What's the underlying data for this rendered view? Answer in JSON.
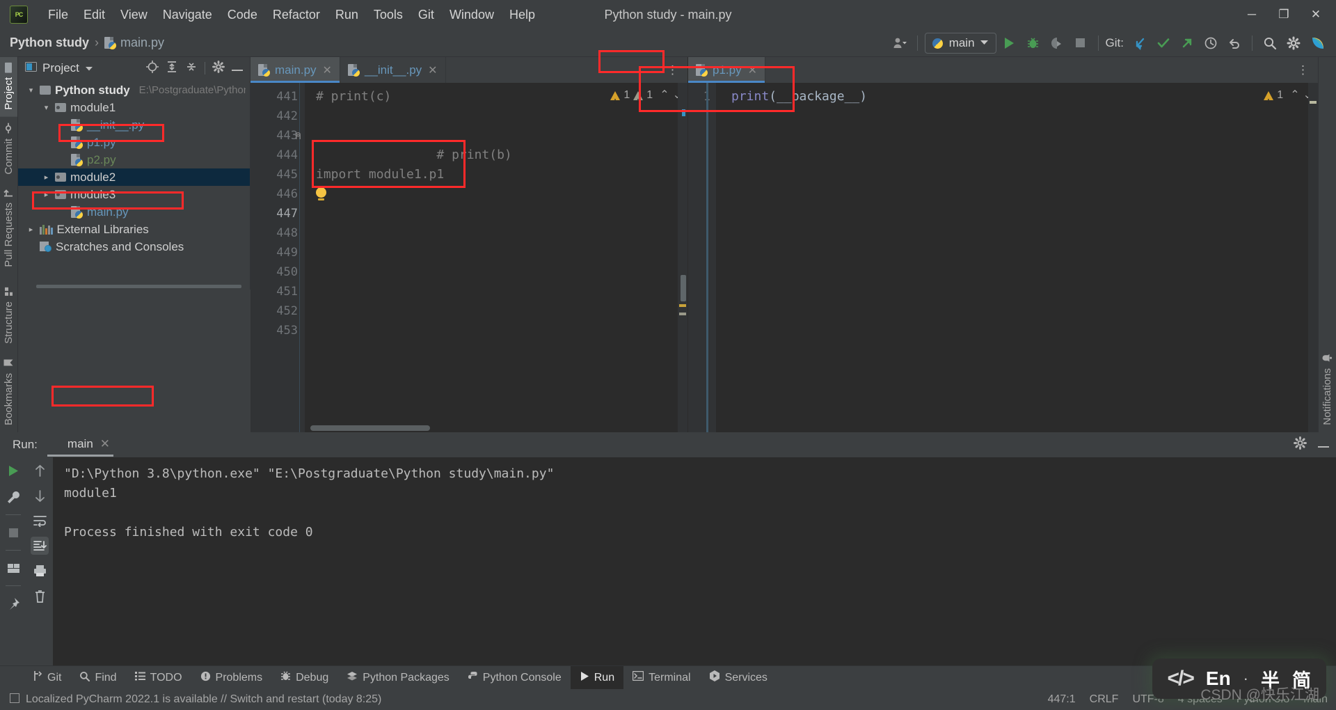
{
  "window": {
    "title": "Python study - main.py",
    "minimize": "─",
    "maximize": "❐",
    "close": "✕"
  },
  "menubar": {
    "logo": "PC",
    "items": [
      "File",
      "Edit",
      "View",
      "Navigate",
      "Code",
      "Refactor",
      "Run",
      "Tools",
      "Git",
      "Window",
      "Help"
    ]
  },
  "navbar": {
    "breadcrumb_project": "Python study",
    "breadcrumb_sep": "›",
    "breadcrumb_file": "main.py",
    "run_config": "main",
    "git_label": "Git:",
    "icons": {
      "account": "account-icon",
      "run": "run-icon",
      "debug": "debug-icon",
      "coverage": "coverage-icon",
      "stop": "stop-icon",
      "git_update": "git-update-icon",
      "git_commit": "git-commit-icon",
      "git_push": "git-push-icon",
      "git_history": "git-history-icon",
      "git_rollback": "git-rollback-icon",
      "search": "search-icon",
      "settings": "gear-icon",
      "plugin": "plugin-icon"
    }
  },
  "left_strip": {
    "top": [
      "Project",
      "Commit",
      "Pull Requests"
    ],
    "bottom": [
      "Structure",
      "Bookmarks"
    ],
    "active": "Project"
  },
  "right_strip": {
    "label": "Notifications"
  },
  "project_panel": {
    "title": "Project",
    "tree": [
      {
        "label": "Python study",
        "path": "E:\\Postgraduate\\Python s",
        "depth": 0,
        "kind": "root-folder",
        "expanded": true,
        "color": "white",
        "bold": true
      },
      {
        "label": "module1",
        "path": "",
        "depth": 1,
        "kind": "package-folder",
        "expanded": true,
        "color": "white",
        "bold": false
      },
      {
        "label": "__init__.py",
        "path": "",
        "depth": 2,
        "kind": "python-file",
        "color": "blue"
      },
      {
        "label": "p1.py",
        "path": "",
        "depth": 2,
        "kind": "python-file",
        "color": "blue",
        "highlighted": true
      },
      {
        "label": "p2.py",
        "path": "",
        "depth": 2,
        "kind": "python-file",
        "color": "green"
      },
      {
        "label": "module2",
        "path": "",
        "depth": 1,
        "kind": "package-folder",
        "expanded": false,
        "color": "white",
        "selected": true
      },
      {
        "label": "module3",
        "path": "",
        "depth": 1,
        "kind": "package-folder",
        "expanded": false,
        "color": "white"
      },
      {
        "label": "main.py",
        "path": "",
        "depth": 2,
        "kind": "python-file",
        "color": "blue",
        "highlighted": true
      },
      {
        "label": "External Libraries",
        "path": "",
        "depth": 0,
        "kind": "libraries",
        "expanded": false,
        "color": "white"
      },
      {
        "label": "Scratches and Consoles",
        "path": "",
        "depth": 0,
        "kind": "scratches",
        "color": "white"
      }
    ]
  },
  "editor_left": {
    "tabs": [
      {
        "label": "main.py",
        "active": true
      },
      {
        "label": "__init__.py",
        "active": false
      }
    ],
    "line_numbers": [
      "441",
      "442",
      "443",
      "444",
      "445",
      "446",
      "447",
      "448",
      "449",
      "450",
      "451",
      "452",
      "453"
    ],
    "current_line": "447",
    "lines": [
      {
        "n": "441",
        "text": "# print(c)",
        "type": "comment"
      },
      {
        "n": "442",
        "text": "# print(b)",
        "type": "comment",
        "fold": true
      },
      {
        "n": "443",
        "text": "",
        "type": "blank"
      },
      {
        "n": "444",
        "text": "",
        "type": "blank"
      },
      {
        "n": "445",
        "text": "import module1.p1",
        "type": "comment"
      },
      {
        "n": "446",
        "text": "",
        "type": "bulb"
      },
      {
        "n": "447",
        "text": "",
        "type": "blank"
      }
    ],
    "inspection": {
      "warnings": "1",
      "weak_warnings": "1",
      "up": "⌃",
      "down": "⌄"
    }
  },
  "editor_right": {
    "tabs": [
      {
        "label": "p1.py",
        "active": true
      }
    ],
    "line_numbers": [
      "1"
    ],
    "code_keyword": "print",
    "code_args": "(__package__)",
    "inspection": {
      "warnings": "1"
    }
  },
  "run_panel": {
    "label": "Run:",
    "tab": "main",
    "output": [
      "\"D:\\Python 3.8\\python.exe\" \"E:\\Postgraduate\\Python study\\main.py\"",
      "module1",
      "",
      "Process finished with exit code 0"
    ],
    "highlighted_output": "module1",
    "toolbar_left": [
      "rerun-icon",
      "settings-wrench-icon",
      "stop-icon",
      "layout-icon",
      "pin-icon"
    ],
    "toolbar_right": [
      "up-arrow-icon",
      "down-arrow-icon",
      "soft-wrap-icon",
      "scroll-to-end-icon",
      "print-icon",
      "trash-icon"
    ]
  },
  "bottom_tabs": [
    {
      "label": "Git",
      "icon": "git-icon",
      "active": false
    },
    {
      "label": "Find",
      "icon": "search-icon",
      "active": false
    },
    {
      "label": "TODO",
      "icon": "todo-icon",
      "active": false
    },
    {
      "label": "Problems",
      "icon": "problems-icon",
      "active": false
    },
    {
      "label": "Debug",
      "icon": "debug-icon",
      "active": false
    },
    {
      "label": "Python Packages",
      "icon": "packages-icon",
      "active": false
    },
    {
      "label": "Python Console",
      "icon": "python-icon",
      "active": false
    },
    {
      "label": "Run",
      "icon": "run-icon",
      "active": true
    },
    {
      "label": "Terminal",
      "icon": "terminal-icon",
      "active": false
    },
    {
      "label": "Services",
      "icon": "services-icon",
      "active": false
    }
  ],
  "status_bar": {
    "message": "Localized PyCharm 2022.1 is available // Switch and restart (today 8:25)",
    "caret": "447:1",
    "line_separator": "CRLF",
    "encoding": "UTF-8",
    "indent": "4 spaces",
    "interpreter": "Python 3.8",
    "branch": "main"
  },
  "ime_widget": {
    "code": "</>",
    "lang": "En",
    "dot": "·",
    "width_mode": "半",
    "script_mode": "简"
  },
  "watermark": "CSDN @快乐江湖",
  "colors": {
    "accent_blue": "#4a88c7",
    "annotation_red": "#ff2a2a",
    "file_blue": "#6897bb",
    "file_green": "#6a8759",
    "selection": "#0d293e",
    "panel_bg": "#3c3f41",
    "editor_bg": "#2b2b2b"
  }
}
